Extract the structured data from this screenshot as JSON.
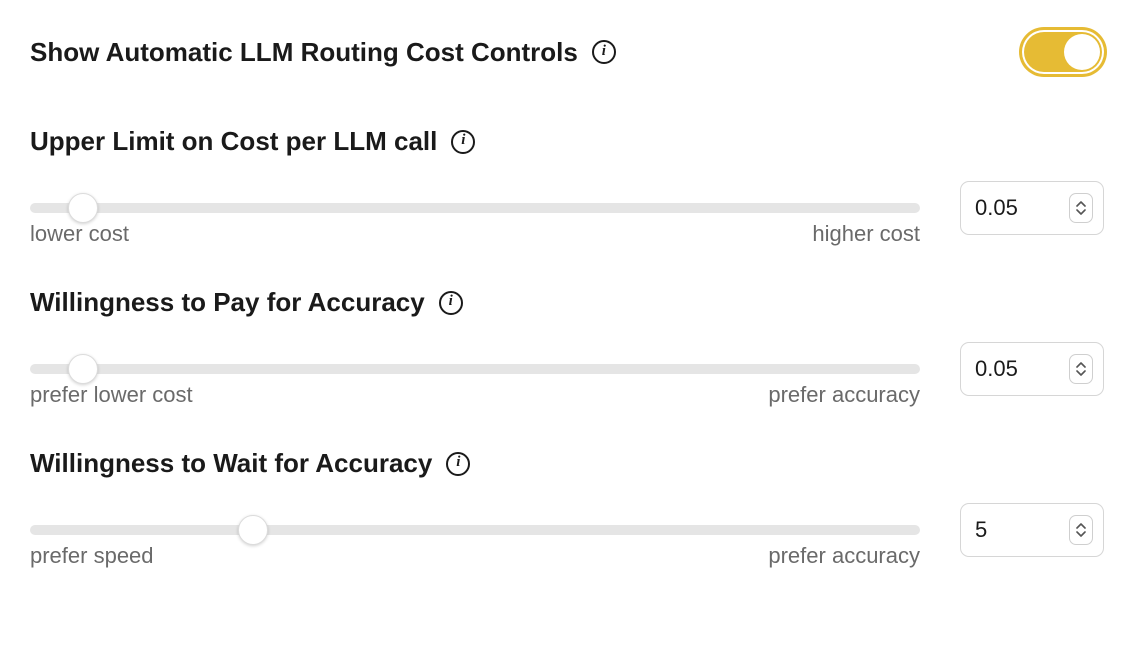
{
  "header": {
    "title": "Show Automatic LLM Routing Cost Controls",
    "toggle_on": true
  },
  "settings": [
    {
      "label": "Upper Limit on Cost per LLM call",
      "slider": {
        "left_caption": "lower cost",
        "right_caption": "higher cost",
        "thumb_percent": 6
      },
      "value": "0.05"
    },
    {
      "label": "Willingness to Pay for Accuracy",
      "slider": {
        "left_caption": "prefer lower cost",
        "right_caption": "prefer accuracy",
        "thumb_percent": 6
      },
      "value": "0.05"
    },
    {
      "label": "Willingness to Wait for Accuracy",
      "slider": {
        "left_caption": "prefer speed",
        "right_caption": "prefer accuracy",
        "thumb_percent": 25
      },
      "value": "5"
    }
  ]
}
